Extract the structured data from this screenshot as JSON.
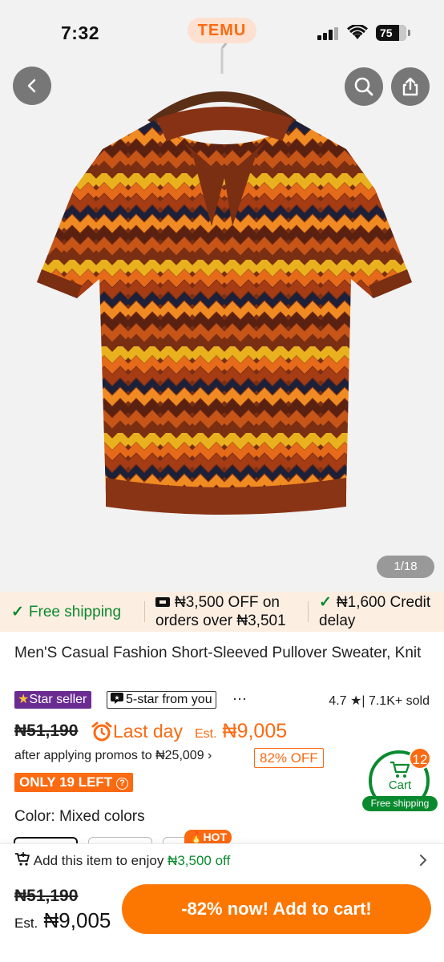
{
  "status_bar": {
    "time": "7:32",
    "battery": "75"
  },
  "app": {
    "logo": "TEMU"
  },
  "image": {
    "counter": "1/18"
  },
  "benefits": {
    "free_shipping": "Free shipping",
    "promo_line1": "₦3,500 OFF on",
    "promo_line2": "orders over ₦3,501",
    "credit_line1": "₦1,600 Credit",
    "credit_line2": "delay"
  },
  "product": {
    "title": "Men'S Casual Fashion Short-Sleeved Pullover Sweater, Knit",
    "star_seller": "Star seller",
    "five_star": "5-star from you",
    "more": "···",
    "rating": "4.7",
    "sold": "| 7.1K+ sold",
    "original_price": "₦51,190",
    "last_day": "Last day",
    "est_label": "Est.",
    "est_price": "₦9,005",
    "promo_text": "after applying promos to ₦25,009",
    "promo_chevron": "›",
    "off_badge": "82% OFF",
    "stock_badge": "ONLY 19 LEFT",
    "color_label": "Color: Mixed colors",
    "hot_badge": "HOT"
  },
  "cart": {
    "count": "12",
    "label": "Cart",
    "shipping": "Free shipping"
  },
  "bottom": {
    "hint_prefix": "Add this item to enjoy",
    "hint_amount": "₦3,500 off",
    "original_price": "₦51,190",
    "est_label": "Est.",
    "est_price": "₦9,005",
    "cta": "-82% now! Add to cart!"
  },
  "colors": {
    "accent": "#fb7701",
    "green": "#0a8a2e",
    "purple": "#6a2c91"
  },
  "icons": [
    "back-icon",
    "search-icon",
    "share-icon",
    "alarm-icon",
    "cart-icon",
    "chevron-right-icon",
    "check-icon",
    "coupon-icon",
    "fire-icon"
  ]
}
